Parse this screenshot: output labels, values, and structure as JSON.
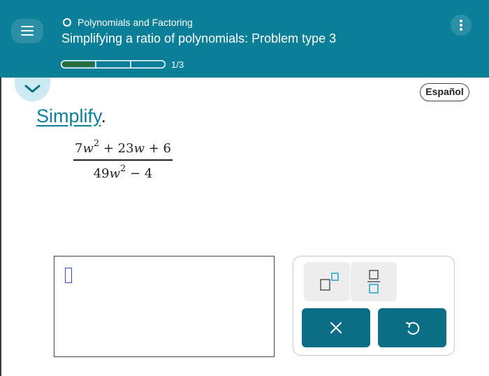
{
  "header": {
    "topic": "Polynomials and Factoring",
    "problem_title": "Simplifying a ratio of polynomials: Problem type 3",
    "progress": {
      "completed": 1,
      "total": 3,
      "label": "1/3"
    },
    "background_color": "#0a7f97"
  },
  "language_button": "Español",
  "instruction": {
    "link": "Simplify",
    "suffix": "."
  },
  "expression": {
    "numerator": {
      "term1_coef": "7",
      "term1_var": "w",
      "term1_exp": "2",
      "term2": "+ 23",
      "term2_var": "w",
      "term3": "+ 6"
    },
    "denominator": {
      "term1_coef": "49",
      "term1_var": "w",
      "term1_exp": "2",
      "term2": "− 4"
    }
  },
  "keypad": {
    "buttons": [
      {
        "name": "exponent",
        "icon": "superscript-template-icon"
      },
      {
        "name": "fraction",
        "icon": "fraction-template-icon"
      },
      {
        "name": "clear",
        "icon": "x-icon"
      },
      {
        "name": "undo",
        "icon": "undo-icon"
      }
    ],
    "accent_color": "#0b6e84",
    "icon_color": "#1ea0c8"
  }
}
